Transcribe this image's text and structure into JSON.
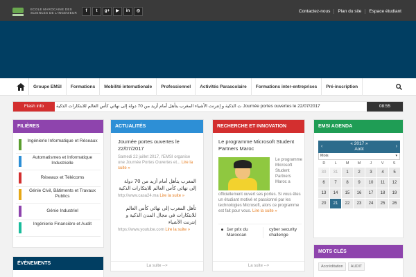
{
  "topbar": {
    "logo_text": "ECOLE MAROCAINE DES SCIENCES DE L'INGENIEUR",
    "social": [
      {
        "icon": "facebook-icon",
        "glyph": "f"
      },
      {
        "icon": "twitter-icon",
        "glyph": "t"
      },
      {
        "icon": "google-plus-icon",
        "glyph": "g+"
      },
      {
        "icon": "youtube-icon",
        "glyph": "▶"
      },
      {
        "icon": "linkedin-icon",
        "glyph": "in"
      },
      {
        "icon": "instagram-icon",
        "glyph": "◎"
      }
    ],
    "links": [
      "Contactez-nous",
      "Plan du site",
      "Espace étudiant"
    ]
  },
  "nav": {
    "items": [
      "Groupe EMSI",
      "Formations",
      "Mobilité internationale",
      "Professionnel",
      "Activités Parascolaire",
      "Formations inter-entreprises",
      "Pré-inscription"
    ]
  },
  "flash": {
    "label": "Flash info",
    "text": "ت الذكية و إنترنت الأشياء  المغرب يتأهل أمام أزيد من 70 دولة إلى نهائي كأس العالم للابتكارات الذكية    Journée portes ouvertes le 22/07/2017",
    "time": "08:55"
  },
  "filieres": {
    "title": "FILIÈRES",
    "items": [
      {
        "label": "Ingénierie Informatique et Réseaux",
        "color": "#5a9e2f"
      },
      {
        "label": "Automatismes et Informatique Industrielle",
        "color": "#2d8fd6"
      },
      {
        "label": "Réseaux et Télécoms",
        "color": "#d32f2f"
      },
      {
        "label": "Génie Civil, Bâtiments et Travaux Publics",
        "color": "#e6a817"
      },
      {
        "label": "Génie Industriel",
        "color": "#8e44ad"
      },
      {
        "label": "Ingénierie Financière et Audit",
        "color": "#1abc9c"
      }
    ]
  },
  "events": {
    "title": "ÉVÈNEMENTS"
  },
  "actualites": {
    "title": "ACTUALITÉS",
    "headline": "Journée portes ouvertes le 22/07/2017",
    "meta": "Samedi 22 juillet 2017, l'EMSI organise une Journée Portes Ouvertes et...",
    "read_more": "Lire la suite »",
    "ar1": "المغرب يتأهل أمام أزيد من 70 دولة إلى نهائي كأس العالم للابتكارات الذكية",
    "src1": "http://www.casa24.ma",
    "ar2": "تأهل المغرب إلى نهائي كأس العالم للابتكارات في مجال المدن الذكية و إنترنت الأشياء",
    "src2": "https://www.youtube.com",
    "more": "La suite -->"
  },
  "recherche": {
    "title": "RECHERCHE ET INNOVATION",
    "headline": "Le programme Microsoft Student Partners Maroc",
    "side": "Le programme Microsoft Student Partners Maroc a",
    "body": "officiellement ouvert ses portes. Si vous êtes un étudiant motivé et passionné par les technologies Microsoft, alors ce programme est fait pour vous.",
    "read_more": "Lire la suite »",
    "tab1": "1er prix du Maroccan",
    "tab2": "cyber security challenge",
    "more": "La suite -->"
  },
  "agenda": {
    "title": "EMSI AGENDA",
    "year": "« 2017 »",
    "month": "Août",
    "mois_label": "Mois",
    "dow": [
      "D",
      "L",
      "M",
      "M",
      "J",
      "V",
      "S"
    ],
    "days": [
      "30",
      "31",
      "1",
      "2",
      "3",
      "4",
      "5",
      "6",
      "7",
      "8",
      "9",
      "10",
      "11",
      "12",
      "13",
      "14",
      "15",
      "16",
      "17",
      "18",
      "19",
      "20",
      "21",
      "22",
      "23",
      "24",
      "25",
      "26"
    ],
    "today": "21",
    "prev_days": [
      "30",
      "31"
    ]
  },
  "mots": {
    "title": "MOTS CLÉS",
    "tags": [
      "Accréditation",
      "AUDIT"
    ]
  }
}
